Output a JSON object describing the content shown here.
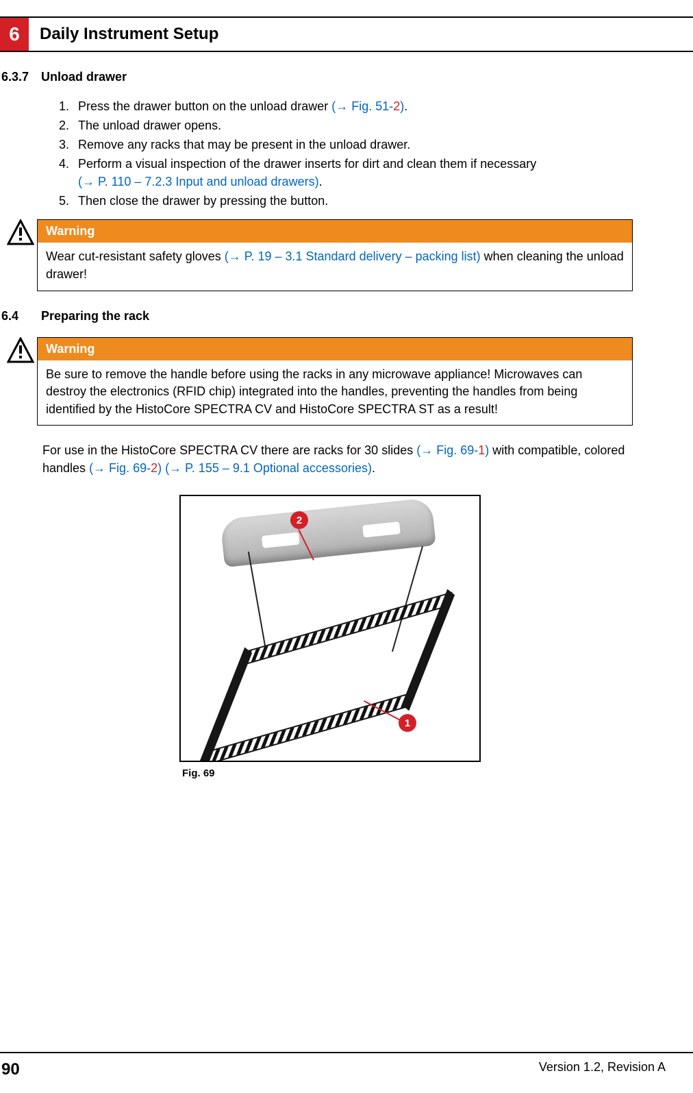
{
  "header": {
    "chapter_number": "6",
    "chapter_title": "Daily Instrument Setup"
  },
  "section_637": {
    "number": "6.3.7",
    "title": "Unload drawer",
    "steps": {
      "s1_a": "Press the drawer button on the unload drawer ",
      "s1_link_prefix": "(→ Fig.  51-",
      "s1_link_num": "2",
      "s1_link_suffix": ")",
      "s1_b": ".",
      "s2": "The unload drawer opens.",
      "s3": "Remove any racks that may be present in the unload drawer.",
      "s4_a": "Perform a visual inspection of the drawer inserts for dirt and clean them if necessary ",
      "s4_link": "(→ P. 110 – 7.2.3 Input and unload drawers)",
      "s4_b": ".",
      "s5": "Then close the drawer by pressing the button."
    }
  },
  "warning1": {
    "label": "Warning",
    "text_a": "Wear cut-resistant safety gloves ",
    "link": "(→ P. 19 – 3.1 Standard delivery – packing list)",
    "text_b": " when cleaning the unload drawer!"
  },
  "section_64": {
    "number": "6.4",
    "title": "Preparing the rack"
  },
  "warning2": {
    "label": "Warning",
    "text": "Be sure to remove the handle before using the racks in any microwave appliance! Microwaves can destroy the electronics (RFID chip) integrated into the handles, preventing the handles from being identified by the HistoCore SPECTRA CV and HistoCore SPECTRA ST as a result!"
  },
  "intro": {
    "text_a": "For use in the HistoCore SPECTRA CV there are racks for 30 slides ",
    "link1_prefix": "(→ Fig.  69-",
    "link1_num": "1",
    "link1_suffix": ")",
    "text_b": " with compatible, colored handles ",
    "link2_prefix": "(→ Fig.  69-",
    "link2_num": "2",
    "link2_suffix": ")",
    "space": " ",
    "link3": "(→ P. 155 – 9.1 Optional accessories)",
    "text_c": "."
  },
  "figure": {
    "caption": "Fig.  69",
    "callout1": "1",
    "callout2": "2"
  },
  "footer": {
    "page": "90",
    "version": "Version 1.2, Revision A"
  }
}
